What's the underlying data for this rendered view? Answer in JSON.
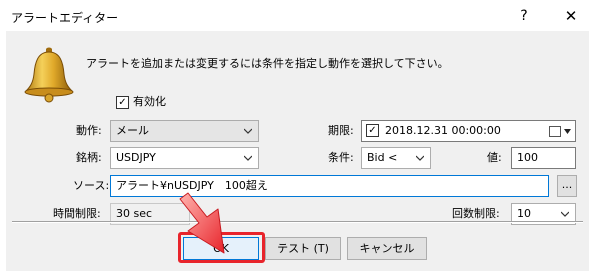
{
  "window": {
    "title": "アラートエディター",
    "help_icon": "?",
    "close_icon": "✕"
  },
  "instruction": "アラートを追加または変更するには条件を指定し動作を選択して下さい。",
  "enabled": {
    "label": "有効化",
    "checked": true
  },
  "action": {
    "label": "動作:",
    "value": "メール"
  },
  "expiry": {
    "label": "期限:",
    "value": "2018.12.31 00:00:00",
    "checked": true
  },
  "symbol": {
    "label": "銘柄:",
    "value": "USDJPY"
  },
  "condition": {
    "label": "条件:",
    "value": "Bid <"
  },
  "value_field": {
    "label": "値:",
    "value": "100"
  },
  "source": {
    "label": "ソース:",
    "value": "アラート¥nUSDJPY　100超え",
    "browse_label": "..."
  },
  "timeout": {
    "label": "時間制限:",
    "value": "30 sec"
  },
  "max_iterations": {
    "label": "回数制限:",
    "value": "10"
  },
  "buttons": {
    "ok": "OK",
    "test": "テスト (T)",
    "cancel": "キャンセル"
  },
  "annotation": {
    "highlight_color": "#e8242b"
  },
  "colors": {
    "accent": "#0078d7",
    "annotation": "#e8242b",
    "client_bg": "#f0f0f0"
  }
}
